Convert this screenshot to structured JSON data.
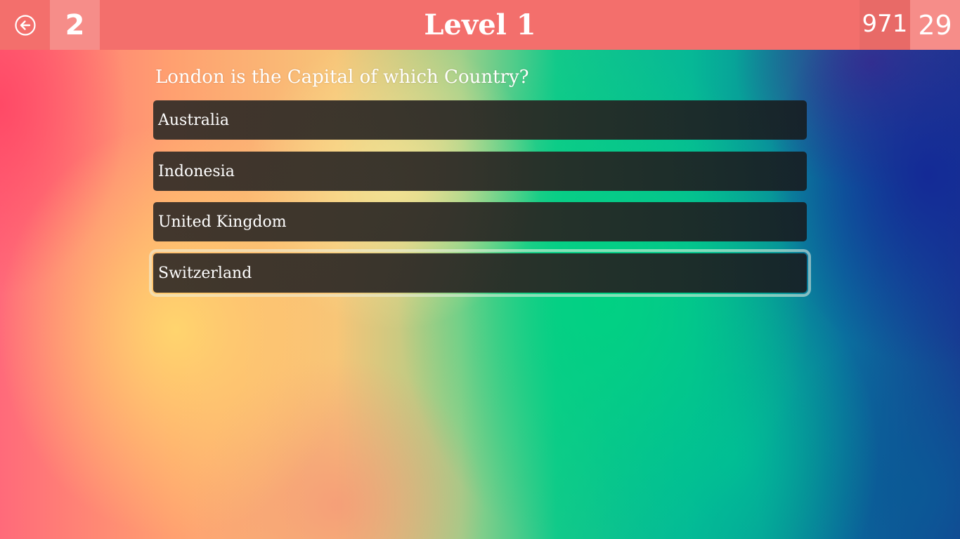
{
  "header": {
    "back_icon": "arrow-left-circle-icon",
    "lives": "2",
    "level_title": "Level 1",
    "score": "971",
    "timer": "29",
    "colors": {
      "bar": "#f36f6c",
      "lives_box": "#f68d89",
      "score_box": "#e86a67"
    }
  },
  "quiz": {
    "question": "London is the Capital of which Country?",
    "answers": [
      {
        "label": "Australia"
      },
      {
        "label": "Indonesia"
      },
      {
        "label": "United Kingdom"
      },
      {
        "label": "Switzerland"
      }
    ],
    "selected_index": 3
  }
}
